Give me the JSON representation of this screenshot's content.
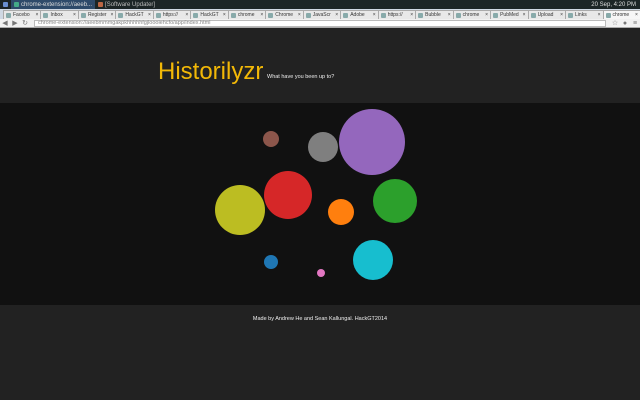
{
  "system": {
    "tabs": [
      {
        "label": "chrome-extension://aeeb...",
        "active": true
      },
      {
        "label": "[Software Updater]",
        "active": false
      }
    ],
    "clock": "20 Sep, 4:20 PM"
  },
  "browser": {
    "tabs": [
      "Facebo",
      "Inbox",
      "Register",
      "HackGT",
      "https://",
      "HackGT",
      "chrome",
      "Chrome",
      "JavaScr",
      "Adobe",
      "https://",
      "Bubble",
      "chrome",
      "PubMed",
      "Upload",
      "Links",
      "chrome"
    ],
    "url": "chrome-extension://aeebmmmgakpkhhhhhfgjloooiehcfo/app/index.html"
  },
  "header": {
    "title": "Historilyzr",
    "subtitle": "What have you been up to?"
  },
  "bubbles": [
    {
      "color": "#8c564b"
    },
    {
      "color": "#7f7f7f"
    },
    {
      "color": "#9467bd"
    },
    {
      "color": "#bcbd22"
    },
    {
      "color": "#d62728"
    },
    {
      "color": "#ff7f0e"
    },
    {
      "color": "#2ca02c"
    },
    {
      "color": "#1f77b4"
    },
    {
      "color": "#e377c2"
    },
    {
      "color": "#17becf"
    }
  ],
  "footer": {
    "credit": "Made by Andrew He and Sean Kallungal. HackGT2014"
  }
}
